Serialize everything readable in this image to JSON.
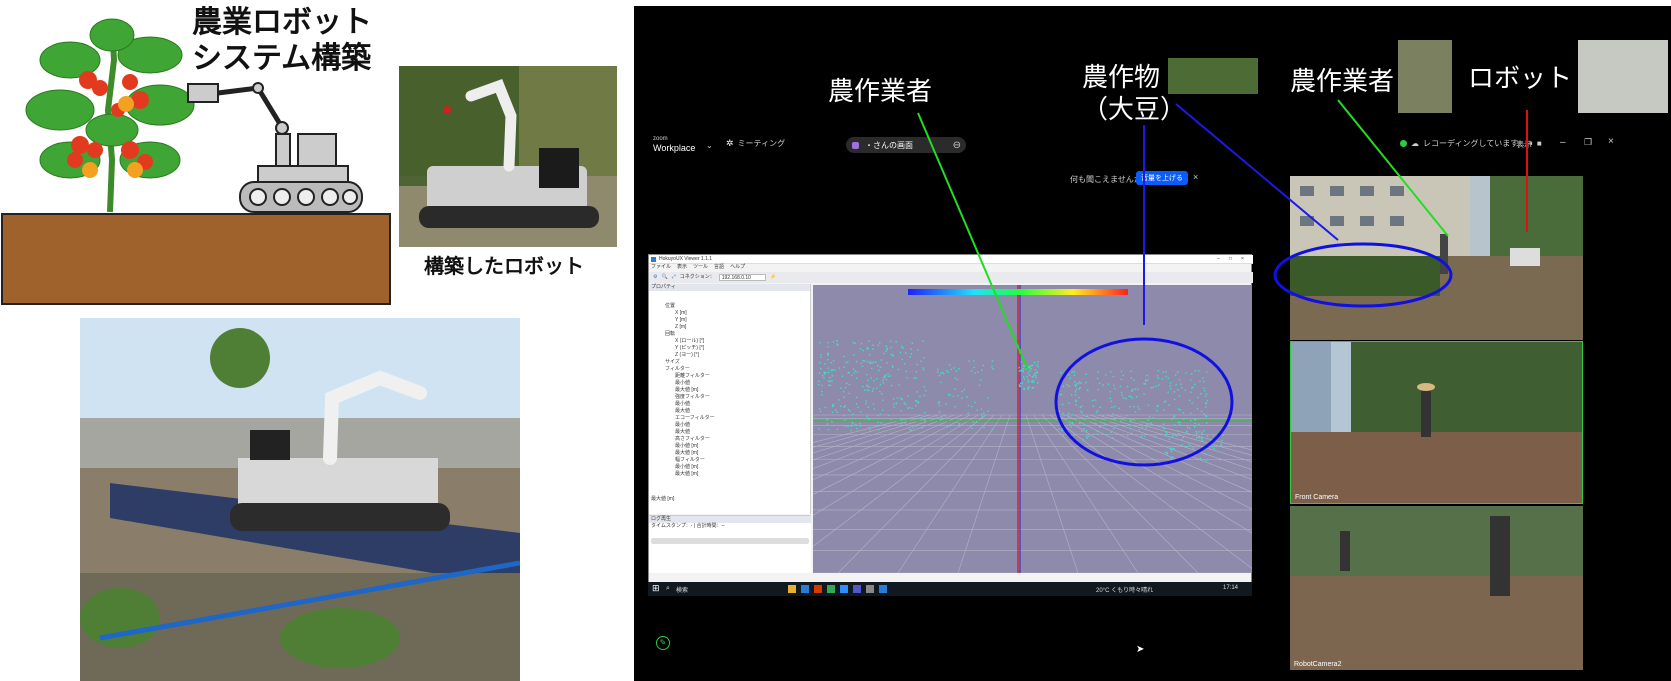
{
  "left_panel": {
    "title_line1": "農業ロボット",
    "title_line2": "システム構築",
    "robot_caption": "構築したロボット"
  },
  "zoom": {
    "brand_small": "zoom",
    "brand": "Workplace",
    "meeting_menu": "ミーティング",
    "shared_title": "・さんの画面",
    "audio_prompt": "何も聞こえませんか？",
    "audio_button": "音量を上げる",
    "recording_text": "レコーディングしています...",
    "view_label": "表示"
  },
  "annotations": {
    "worker_center": "農作業者",
    "crop_line1": "農作物",
    "crop_line2": "（大豆）",
    "worker_right": "農作業者",
    "robot": "ロボット"
  },
  "app": {
    "title": "HokuyoUX Viewer 1.1.1",
    "menu": [
      "ファイル",
      "表示",
      "ツール",
      "言語",
      "ヘルプ"
    ],
    "connection_label": "コネクション：",
    "connection_value": "192.168.0.10",
    "panel_title": "プロパティ",
    "tree": [
      "位置",
      "X [m]",
      "Y [m]",
      "Z [m]",
      "回転",
      "X (ロール) [°]",
      "Y (ピッチ) [°]",
      "Z (ヨー) [°]",
      "サイズ",
      "フィルター",
      "距離フィルター",
      "最小値",
      "最大値 [m]",
      "強度フィルター",
      "最小値",
      "最大値",
      "エコーフィルター",
      "最小値",
      "最大値",
      "高さフィルター",
      "最小値 [m]",
      "最大値 [m]",
      "幅フィルター",
      "最小値 [m]",
      "最大値 [m]"
    ],
    "footer_label": "最大値 [m]",
    "log_title": "ログ再生",
    "log_line": "タイムスタンプ：-  |  合計時間：--",
    "search_placeholder": "検索",
    "weather": "20°C くもり時々晴れ",
    "clock": "17:14"
  },
  "tiles": [
    {
      "label": ""
    },
    {
      "label": "Front Camera"
    },
    {
      "label": "RobotCamera2"
    }
  ],
  "colors": {
    "zoom_bg": "#000000",
    "viewport_bg": "#8e8aab",
    "point_cloud": "#40e0c8",
    "ellipse": "#1010e0",
    "green_line": "#22dd22",
    "red_line": "#dd1111",
    "blue_line": "#1a1ae8",
    "audio_button": "#0b5cff"
  }
}
